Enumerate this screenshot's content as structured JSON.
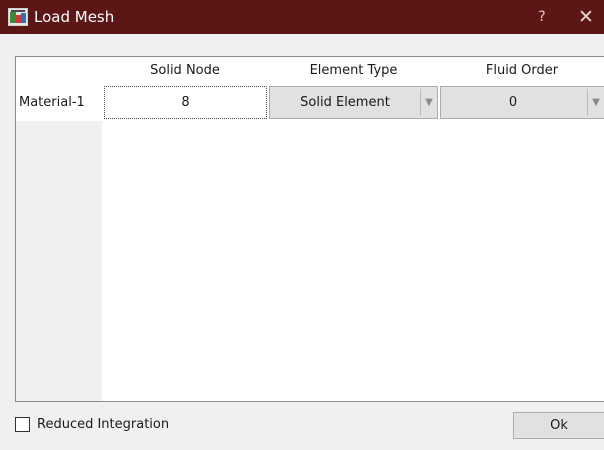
{
  "window": {
    "title": "Load Mesh",
    "help_label": "?",
    "close_label": "✕",
    "titlebar_color": "#5c1616"
  },
  "table": {
    "columns": [
      "Solid Node",
      "Element Type",
      "Fluid Order"
    ],
    "rows": [
      {
        "label": "Material-1",
        "solid_node": "8",
        "element_type": "Solid Element",
        "fluid_order": "0"
      }
    ],
    "dropdown_arrow": "▼"
  },
  "options": {
    "reduced_integration_label": "Reduced Integration",
    "reduced_integration_checked": false
  },
  "actions": {
    "ok_label": "Ok"
  }
}
